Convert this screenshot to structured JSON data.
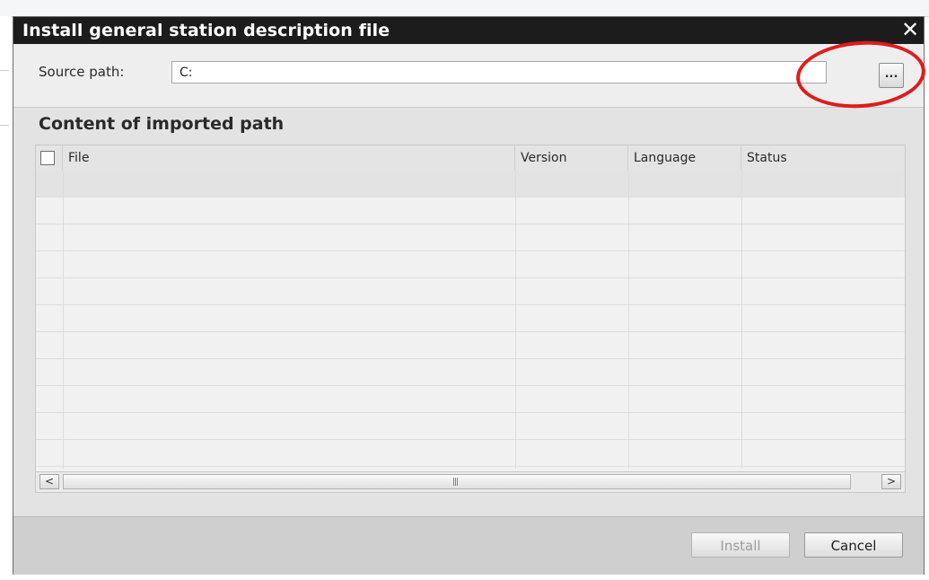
{
  "dialog": {
    "title": "Install general station description file",
    "close_glyph": "✕"
  },
  "source": {
    "label": "Source path:",
    "value": "C:",
    "browse_label": "..."
  },
  "content": {
    "heading": "Content of imported path",
    "columns": [
      "File",
      "Version",
      "Language",
      "Status"
    ],
    "rows": []
  },
  "scrollbar": {
    "left_glyph": "<",
    "right_glyph": ">",
    "grip": "|||"
  },
  "buttons": {
    "install": "Install",
    "cancel": "Cancel"
  },
  "colors": {
    "titlebar": "#1c1c1c",
    "annotation_circle": "#e11b1b"
  }
}
